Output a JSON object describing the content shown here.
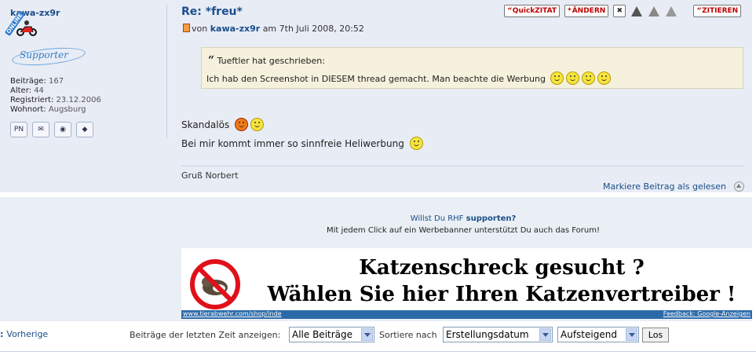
{
  "user": {
    "name": "kawa-zx9r",
    "online_badge": "ONLINE",
    "rank_logo_text": "Supporter",
    "stats": [
      {
        "label": "Beiträge:",
        "value": "167"
      },
      {
        "label": "Alter:",
        "value": "44"
      },
      {
        "label": "Registriert:",
        "value": "23.12.2006"
      },
      {
        "label": "Wohnort:",
        "value": "Augsburg"
      }
    ],
    "contact_icons": [
      "pm-icon",
      "email-icon",
      "homepage-icon",
      "messenger-icon"
    ],
    "pm_label": "PN"
  },
  "post": {
    "title": "Re: *freu*",
    "meta_prefix": "von",
    "author": "kawa-zx9r",
    "meta_suffix": "am 7th Juli 2008, 20:52",
    "actions": {
      "quick_quote_mark": "“",
      "quick_quote_label": "QuickZITAT",
      "edit_mark": "*",
      "edit_label": "ÄNDERN",
      "quote_mark": "“",
      "quote_label": "ZITIEREN"
    },
    "quote": {
      "mark": "“",
      "author_line": "Tueftler hat geschrieben:",
      "text": "Ich hab den Screenshot in DIESEM thread gemacht. Man beachte die Werbung"
    },
    "line1": "Skandalös",
    "line2": "Bei mir kommt immer so sinnfreie Heliwerbung",
    "signature": "Gruß Norbert",
    "mark_read": "Markiere Beitrag als gelesen"
  },
  "ad": {
    "support_text": "Willst Du RHF",
    "support_link": "supporten?",
    "support_sub": "Mit jedem Click auf ein Werbebanner unterstützt Du auch das Forum!",
    "headline_1": "Katzenschreck gesucht ?",
    "headline_2": "Wählen Sie hier Ihren Katzenvertreiber !",
    "url": "www.tierabwehr.com/shop/inde",
    "feedback": "Feedback: Google-Anzeigen"
  },
  "nav": {
    "prev_label": "Vorherige",
    "filter_label": "Beiträge der letzten Zeit anzeigen:",
    "filter_value": "Alle Beiträge",
    "sort_label": "Sortiere nach",
    "sort_value": "Erstellungsdatum",
    "order_value": "Aufsteigend",
    "go_label": "Los"
  }
}
